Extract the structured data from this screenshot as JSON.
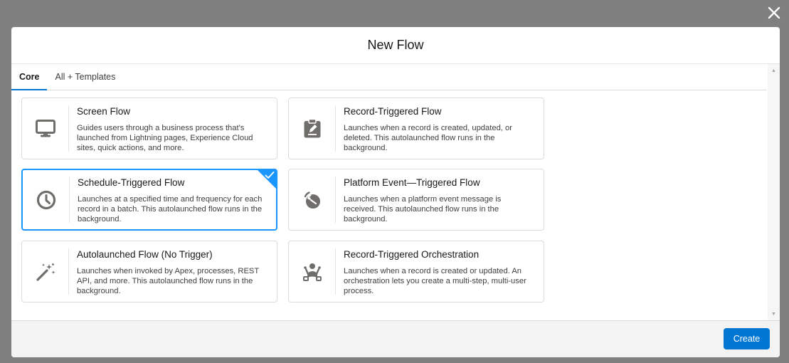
{
  "modal": {
    "title": "New Flow"
  },
  "tabs": [
    {
      "label": "Core",
      "active": true
    },
    {
      "label": "All + Templates",
      "active": false
    }
  ],
  "cards": [
    {
      "icon": "monitor-icon",
      "title": "Screen Flow",
      "description": "Guides users through a business process that's launched from Lightning pages, Experience Cloud sites, quick actions, and more.",
      "selected": false
    },
    {
      "icon": "clipboard-icon",
      "title": "Record-Triggered Flow",
      "description": "Launches when a record is created, updated, or deleted. This autolaunched flow runs in the background.",
      "selected": false
    },
    {
      "icon": "clock-icon",
      "title": "Schedule-Triggered Flow",
      "description": "Launches at a specified time and frequency for each record in a batch. This autolaunched flow runs in the background.",
      "selected": true
    },
    {
      "icon": "platform-event-icon",
      "title": "Platform Event—Triggered Flow",
      "description": "Launches when a platform event message is received. This autolaunched flow runs in the background.",
      "selected": false
    },
    {
      "icon": "magic-wand-icon",
      "title": "Autolaunched Flow (No Trigger)",
      "description": "Launches when invoked by Apex, processes, REST API, and more. This autolaunched flow runs in the background.",
      "selected": false
    },
    {
      "icon": "orchestration-icon",
      "title": "Record-Triggered Orchestration",
      "description": "Launches when a record is created or updated. An orchestration lets you create a multi-step, multi-user process.",
      "selected": false
    }
  ],
  "footer": {
    "create_label": "Create"
  },
  "colors": {
    "brand": "#0176d3",
    "selected_border": "#1b96ff",
    "icon": "#706e6b"
  }
}
